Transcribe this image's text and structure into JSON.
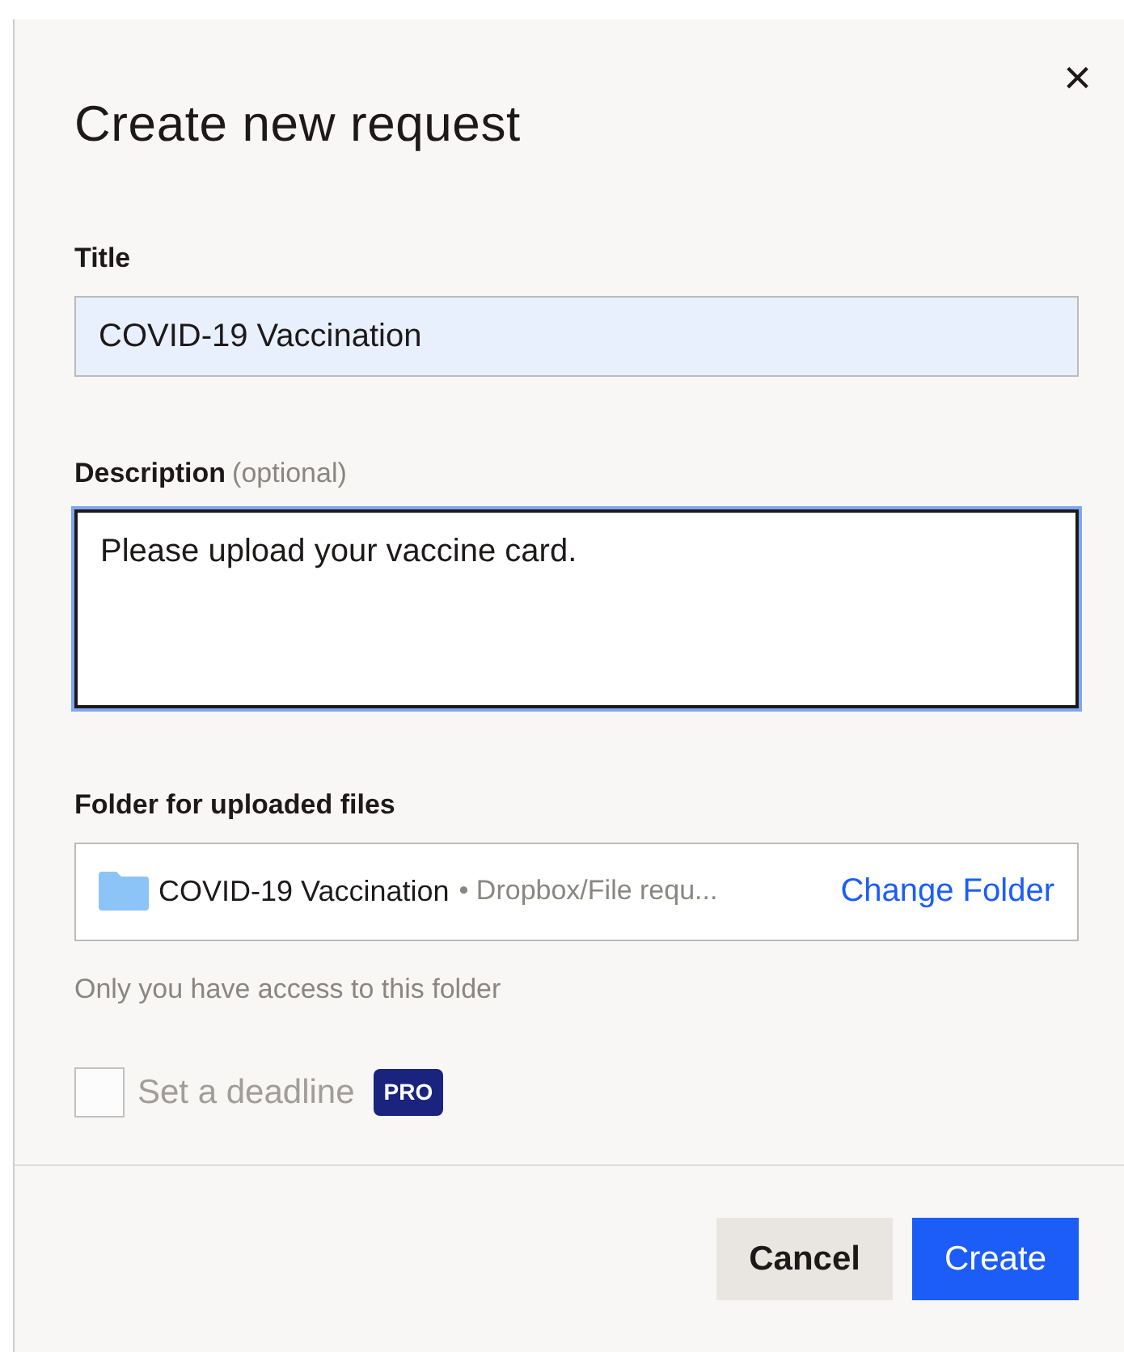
{
  "dialog": {
    "title": "Create new request",
    "close": "×"
  },
  "title_field": {
    "label": "Title",
    "value": "COVID-19 Vaccination",
    "autofilled": true
  },
  "description_field": {
    "label": "Description",
    "optional_note": "(optional)",
    "value": "Please upload your vaccine card.",
    "focused": true
  },
  "folder": {
    "label": "Folder for uploaded files",
    "name": "COVID-19 Vaccination",
    "path": "• Dropbox/File requ...",
    "action": "Change Folder",
    "hint": "Only you have access to this folder"
  },
  "deadline": {
    "label": "Set a deadline",
    "checked": false,
    "disabled": true,
    "badge": "PRO"
  },
  "buttons": [
    {
      "label": "Cancel",
      "kind": "secondary"
    },
    {
      "label": "Create",
      "kind": "primary"
    }
  ]
}
